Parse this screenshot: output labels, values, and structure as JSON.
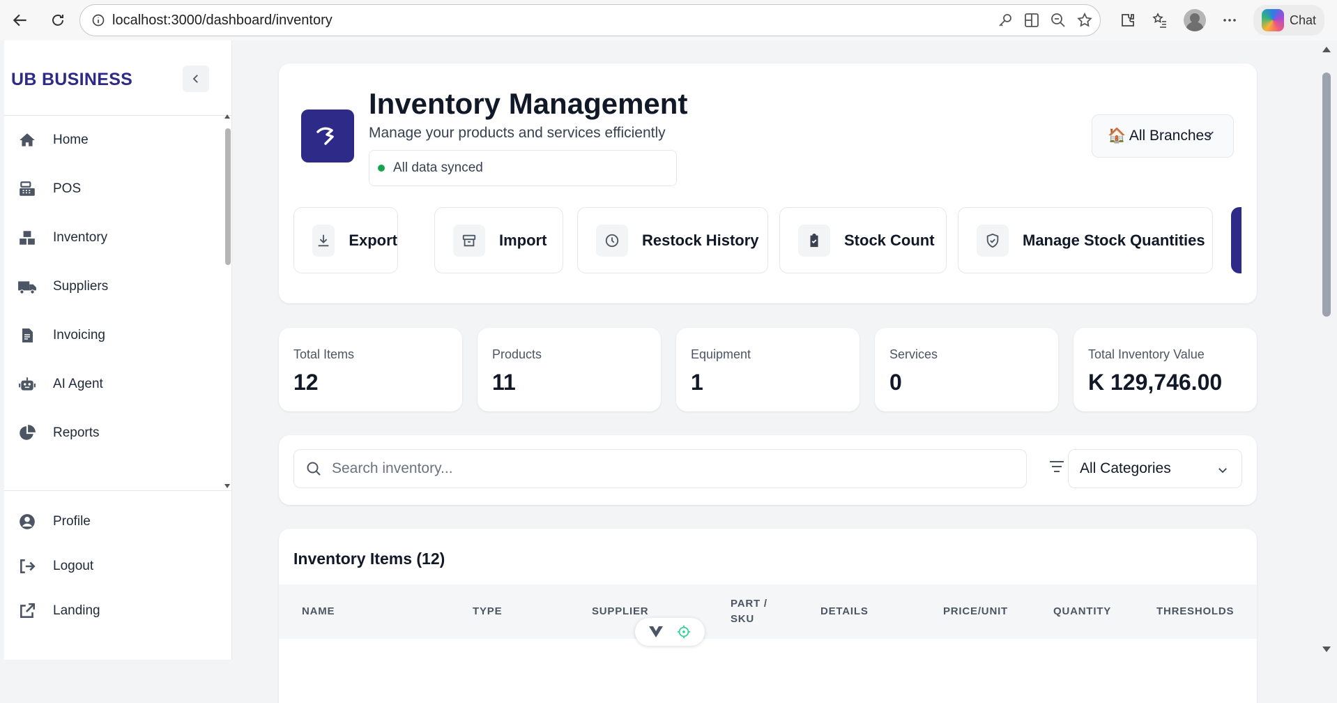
{
  "browser": {
    "url": "localhost:3000/dashboard/inventory",
    "chat_label": "Chat"
  },
  "sidebar": {
    "brand": "UB BUSINESS",
    "items": [
      {
        "label": "Home",
        "icon": "home-icon"
      },
      {
        "label": "POS",
        "icon": "pos-icon"
      },
      {
        "label": "Inventory",
        "icon": "boxes-icon"
      },
      {
        "label": "Suppliers",
        "icon": "truck-icon"
      },
      {
        "label": "Invoicing",
        "icon": "invoice-icon"
      },
      {
        "label": "AI Agent",
        "icon": "robot-icon"
      },
      {
        "label": "Reports",
        "icon": "pie-chart-icon"
      }
    ],
    "bottom_items": [
      {
        "label": "Profile",
        "icon": "user-circle-icon"
      },
      {
        "label": "Logout",
        "icon": "logout-icon"
      },
      {
        "label": "Landing",
        "icon": "external-link-icon"
      }
    ]
  },
  "header": {
    "title": "Inventory Management",
    "subtitle": "Manage your products and services efficiently",
    "sync_status": "All data synced",
    "sync_color": "#16a34a",
    "branch_label": "🏠 All Branches",
    "brand_color": "#2e2a87"
  },
  "actions": [
    {
      "label": "Export",
      "icon": "download-icon"
    },
    {
      "label": "Import",
      "icon": "archive-icon"
    },
    {
      "label": "Restock History",
      "icon": "clock-icon"
    },
    {
      "label": "Stock Count",
      "icon": "clipboard-check-icon"
    },
    {
      "label": "Manage Stock Quantities",
      "icon": "shield-check-icon"
    }
  ],
  "stats": [
    {
      "label": "Total Items",
      "value": "12"
    },
    {
      "label": "Products",
      "value": "11"
    },
    {
      "label": "Equipment",
      "value": "1"
    },
    {
      "label": "Services",
      "value": "0"
    },
    {
      "label": "Total Inventory Value",
      "value": "K 129,746.00"
    }
  ],
  "search": {
    "placeholder": "Search inventory...",
    "category": "All Categories"
  },
  "table": {
    "title": "Inventory Items (12)",
    "columns": [
      "NAME",
      "TYPE",
      "SUPPLIER",
      "PART / SKU",
      "DETAILS",
      "PRICE/UNIT",
      "QUANTITY",
      "THRESHOLDS"
    ]
  }
}
